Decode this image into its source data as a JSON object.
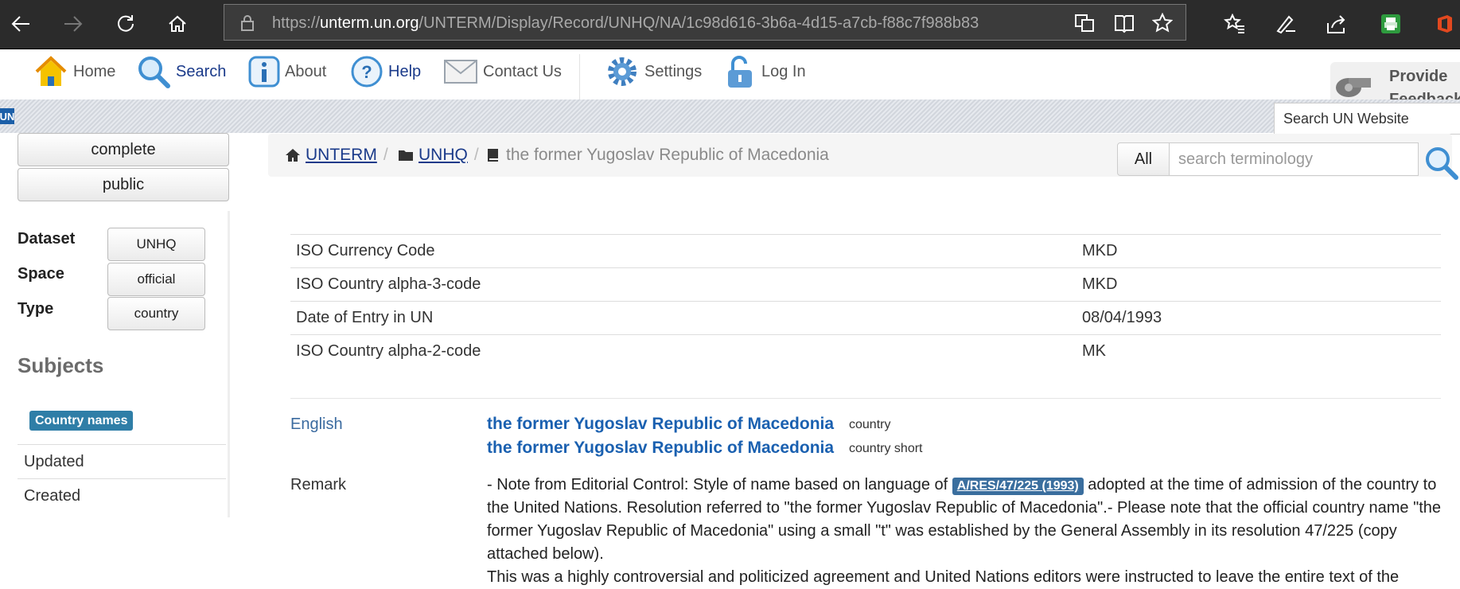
{
  "browser": {
    "url_prefix": "https://",
    "url_host": "unterm.un.org",
    "url_path": "/UNTERM/Display/Record/UNHQ/NA/1c98d616-3b6a-4d15-a7cb-f88c7f988b83"
  },
  "nav": {
    "home": "Home",
    "search": "Search",
    "about": "About",
    "help": "Help",
    "contact": "Contact Us",
    "settings": "Settings",
    "login": "Log In",
    "feedback_line1": "Provide",
    "feedback_line2": "Feedback",
    "search_un": "Search UN Website",
    "un_logo": "UN"
  },
  "sidebar": {
    "btn_complete": "complete",
    "btn_public": "public",
    "dataset_label": "Dataset",
    "dataset_value": "UNHQ",
    "space_label": "Space",
    "space_value": "official",
    "type_label": "Type",
    "type_value": "country",
    "subjects_heading": "Subjects",
    "subject_tag": "Country names",
    "updated": "Updated",
    "created": "Created"
  },
  "breadcrumb": {
    "root": "UNTERM",
    "dataset": "UNHQ",
    "current": "the former Yugoslav Republic of Macedonia",
    "scope": "All",
    "search_placeholder": "search terminology"
  },
  "properties": [
    {
      "label": "ISO Currency Code",
      "value": "MKD"
    },
    {
      "label": "ISO Country alpha-3-code",
      "value": "MKD"
    },
    {
      "label": "Date of Entry in UN",
      "value": "08/04/1993"
    },
    {
      "label": "ISO Country alpha-2-code",
      "value": "MK"
    }
  ],
  "english": {
    "label": "English",
    "terms": [
      {
        "text": "the former Yugoslav Republic of Macedonia",
        "type": "country"
      },
      {
        "text": "the former Yugoslav Republic of Macedonia",
        "type": "country short"
      }
    ]
  },
  "remark": {
    "label": "Remark",
    "before": "- Note from Editorial Control: Style of name based on language of ",
    "link": "A/RES/47/225 (1993)",
    "after": " adopted at the time of admission of the country to the United Nations. Resolution referred to \"the former Yugoslav Republic of Macedonia\".- Please note that the official country name \"the former Yugoslav Republic of Macedonia\" using a small \"t\" was established by the General Assembly in its resolution 47/225 (copy attached below).",
    "para2": "This was a highly controversial and politicized agreement and United Nations editors were instructed to leave the entire text of the"
  },
  "colors": {
    "accent": "#1a3a8a",
    "term_link": "#1a60b0",
    "badge": "#2f7ea7"
  }
}
